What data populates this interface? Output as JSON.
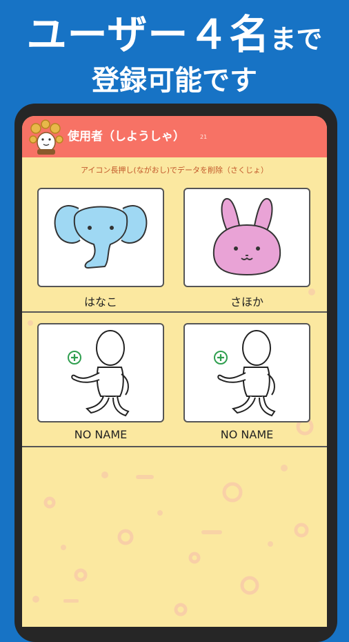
{
  "headline": {
    "line1_main": "ユーザー４名",
    "line1_suffix": "まで",
    "line2": "登録可能です"
  },
  "appbar": {
    "title": "使用者（しようしゃ）",
    "count": "21"
  },
  "hint": "アイコン長押し(ながおし)でデータを削除（さくじょ）",
  "users": [
    {
      "name": "はなこ",
      "icon": "elephant-icon",
      "color": "#9fd8f3"
    },
    {
      "name": "さほか",
      "icon": "rabbit-icon",
      "color": "#e9a3d6"
    },
    {
      "name": "NO NAME",
      "icon": "add-user-icon",
      "color": "#2e9e4e"
    },
    {
      "name": "NO NAME",
      "icon": "add-user-icon",
      "color": "#2e9e4e"
    }
  ],
  "colors": {
    "background": "#1773c5",
    "appbar": "#f77265",
    "screen": "#fbe8a0"
  }
}
